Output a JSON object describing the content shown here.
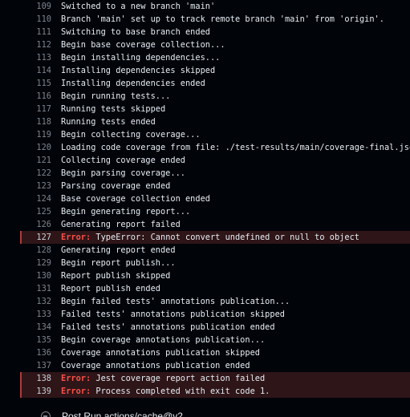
{
  "log": {
    "lines": [
      {
        "num": "109",
        "text": "Switched to a new branch 'main'"
      },
      {
        "num": "110",
        "text": "Branch 'main' set up to track remote branch 'main' from 'origin'."
      },
      {
        "num": "111",
        "text": "Switching to base branch ended"
      },
      {
        "num": "112",
        "text": "Begin base coverage collection..."
      },
      {
        "num": "113",
        "text": "Begin installing dependencies..."
      },
      {
        "num": "114",
        "text": "Installing dependencies skipped"
      },
      {
        "num": "115",
        "text": "Installing dependencies ended"
      },
      {
        "num": "116",
        "text": "Begin running tests..."
      },
      {
        "num": "117",
        "text": "Running tests skipped"
      },
      {
        "num": "118",
        "text": "Running tests ended"
      },
      {
        "num": "119",
        "text": "Begin collecting coverage..."
      },
      {
        "num": "120",
        "text": "Loading code coverage from file: ./test-results/main/coverage-final.json"
      },
      {
        "num": "121",
        "text": "Collecting coverage ended"
      },
      {
        "num": "122",
        "text": "Begin parsing coverage..."
      },
      {
        "num": "123",
        "text": "Parsing coverage ended"
      },
      {
        "num": "124",
        "text": "Base coverage collection ended"
      },
      {
        "num": "125",
        "text": "Begin generating report..."
      },
      {
        "num": "126",
        "text": "Generating report failed"
      },
      {
        "num": "127",
        "prefix": "Error:",
        "text": " TypeError: Cannot convert undefined or null to object"
      },
      {
        "num": "128",
        "text": "Generating report ended"
      },
      {
        "num": "129",
        "text": "Begin report publish..."
      },
      {
        "num": "130",
        "text": "Report publish skipped"
      },
      {
        "num": "131",
        "text": "Report publish ended"
      },
      {
        "num": "132",
        "text": "Begin failed tests' annotations publication..."
      },
      {
        "num": "133",
        "text": "Failed tests' annotations publication skipped"
      },
      {
        "num": "134",
        "text": "Failed tests' annotations publication ended"
      },
      {
        "num": "135",
        "text": "Begin coverage annotations publication..."
      },
      {
        "num": "136",
        "text": "Coverage annotations publication skipped"
      },
      {
        "num": "137",
        "text": "Coverage annotations publication ended"
      },
      {
        "num": "138",
        "prefix": "Error:",
        "text": " Jest coverage report action failed"
      },
      {
        "num": "139",
        "prefix": "Error:",
        "text": " Process completed with exit code 1."
      }
    ]
  },
  "next_step": {
    "icon": "skipped-circle-icon",
    "label": "Post Run actions/cache@v2"
  },
  "colors": {
    "background": "#010409",
    "error_prefix": "#f85149",
    "error_row_bg": "#2e1518",
    "line_number": "#7d8590"
  }
}
